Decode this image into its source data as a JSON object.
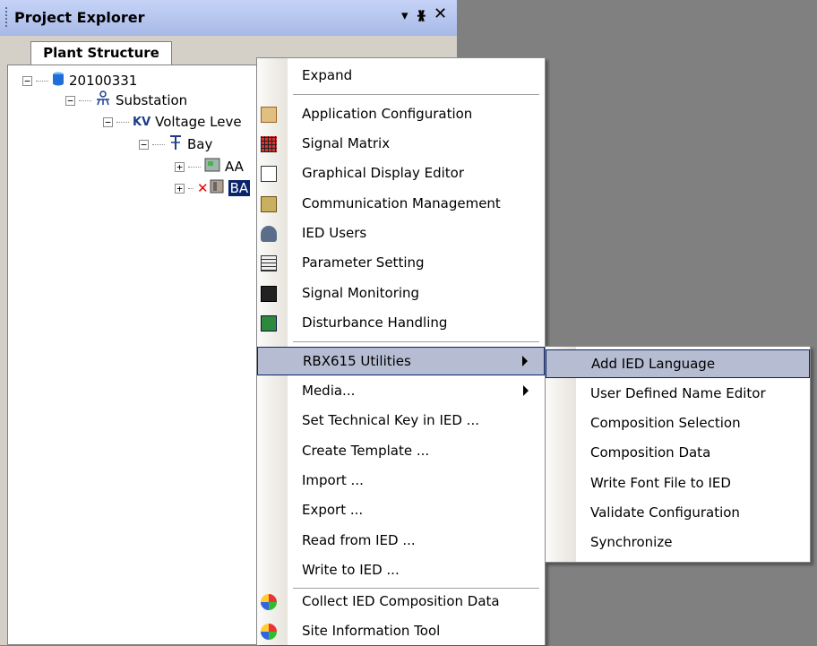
{
  "panel": {
    "title": "Project Explorer",
    "buttons": {
      "dropdown": "▾",
      "pin": "ᚕ",
      "close": "✕"
    },
    "tab": "Plant Structure"
  },
  "tree": [
    {
      "label": "20100331",
      "icon": "database-icon"
    },
    {
      "label": "Substation",
      "icon": "substation-icon"
    },
    {
      "label": "Voltage Leve",
      "icon": "voltage-level-icon"
    },
    {
      "label": "Bay",
      "icon": "bay-icon"
    },
    {
      "label": "AA",
      "icon": "ied-icon"
    },
    {
      "label": "BA",
      "icon": "ied-error-icon"
    }
  ],
  "context_menu": {
    "items": [
      {
        "label": "Expand",
        "icon": ""
      },
      {
        "label": "Application Configuration",
        "icon": "application-configuration-icon"
      },
      {
        "label": "Signal Matrix",
        "icon": "signal-matrix-icon"
      },
      {
        "label": "Graphical Display Editor",
        "icon": "graphical-display-editor-icon"
      },
      {
        "label": "Communication Management",
        "icon": "communication-management-icon"
      },
      {
        "label": "IED Users",
        "icon": "ied-users-icon"
      },
      {
        "label": "Parameter Setting",
        "icon": "parameter-setting-icon"
      },
      {
        "label": "Signal Monitoring",
        "icon": "signal-monitoring-icon"
      },
      {
        "label": "Disturbance Handling",
        "icon": "disturbance-handling-icon"
      },
      {
        "label": "RBX615 Utilities",
        "icon": "",
        "submenu": true,
        "highlighted": true
      },
      {
        "label": "Media...",
        "icon": "",
        "submenu": true
      },
      {
        "label": "Set Technical Key in IED ...",
        "icon": ""
      },
      {
        "label": "Create Template ...",
        "icon": ""
      },
      {
        "label": "Import ...",
        "icon": ""
      },
      {
        "label": "Export ...",
        "icon": ""
      },
      {
        "label": "Read from IED ...",
        "icon": ""
      },
      {
        "label": "Write to IED ...",
        "icon": ""
      },
      {
        "label": "Collect IED Composition Data",
        "icon": "collect-data-icon"
      },
      {
        "label": "Site Information Tool",
        "icon": "site-information-icon"
      }
    ]
  },
  "submenu": {
    "items": [
      {
        "label": "Add IED Language",
        "highlighted": true
      },
      {
        "label": "User Defined Name Editor"
      },
      {
        "label": "Composition Selection"
      },
      {
        "label": "Composition Data"
      },
      {
        "label": "Write Font File to IED"
      },
      {
        "label": "Validate Configuration"
      },
      {
        "label": "Synchronize"
      }
    ]
  },
  "colors": {
    "titlebar": "#a7b9e6",
    "highlight": "#b6bdd2",
    "selection": "#0a246a",
    "background": "#808080"
  }
}
